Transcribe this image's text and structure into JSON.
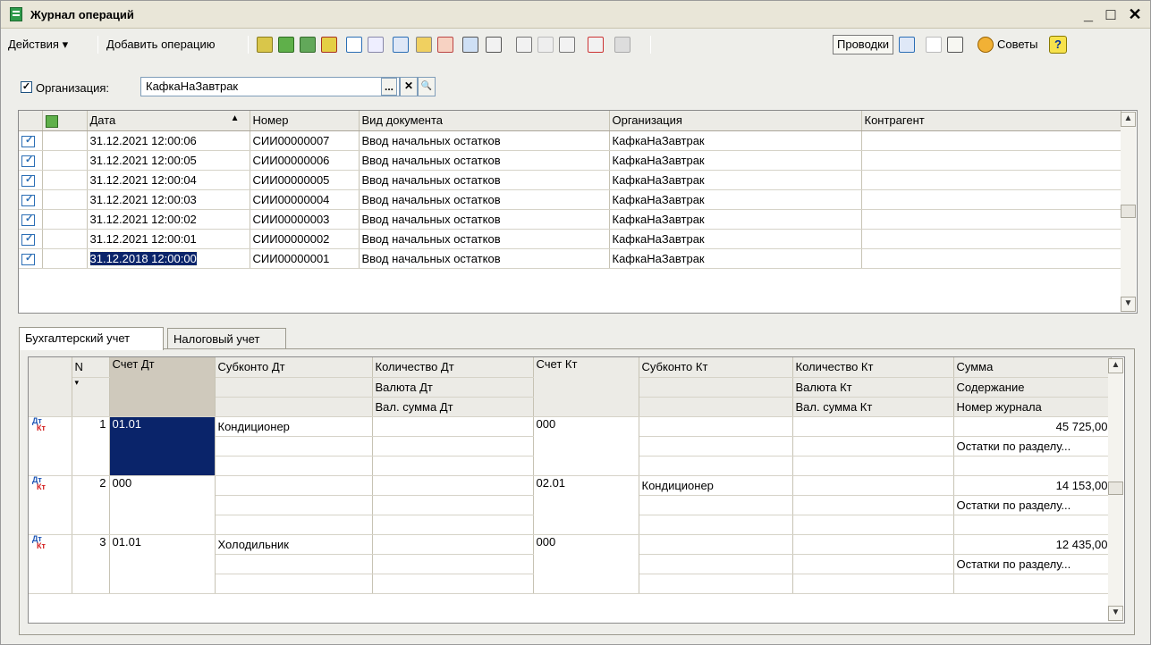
{
  "window": {
    "title": "Журнал операций",
    "minimize": "_",
    "maximize": "□",
    "close": "✕"
  },
  "toolbar": {
    "actions_label": "Действия ▾",
    "add_label": "Добавить операцию",
    "postings_label": "Проводки",
    "tips_label": "Советы",
    "help_label": "?"
  },
  "filter": {
    "checked": "✓",
    "label": "Организация:",
    "value": "КафкаНаЗавтрак",
    "btn_select": "...",
    "btn_clear": "✕",
    "btn_open": "🔍"
  },
  "journal": {
    "columns": [
      "Дата",
      "Номер",
      "Вид документа",
      "Организация",
      "Контрагент"
    ],
    "sort_arrow": "▲",
    "rows": [
      {
        "date": "31.12.2021 12:00:06",
        "number": "СИИ00000007",
        "doc_type": "Ввод начальных остатков",
        "org": "КафкаНаЗавтрак",
        "contractor": ""
      },
      {
        "date": "31.12.2021 12:00:05",
        "number": "СИИ00000006",
        "doc_type": "Ввод начальных остатков",
        "org": "КафкаНаЗавтрак",
        "contractor": ""
      },
      {
        "date": "31.12.2021 12:00:04",
        "number": "СИИ00000005",
        "doc_type": "Ввод начальных остатков",
        "org": "КафкаНаЗавтрак",
        "contractor": ""
      },
      {
        "date": "31.12.2021 12:00:03",
        "number": "СИИ00000004",
        "doc_type": "Ввод начальных остатков",
        "org": "КафкаНаЗавтрак",
        "contractor": ""
      },
      {
        "date": "31.12.2021 12:00:02",
        "number": "СИИ00000003",
        "doc_type": "Ввод начальных остатков",
        "org": "КафкаНаЗавтрак",
        "contractor": ""
      },
      {
        "date": "31.12.2021 12:00:01",
        "number": "СИИ00000002",
        "doc_type": "Ввод начальных остатков",
        "org": "КафкаНаЗавтрак",
        "contractor": ""
      },
      {
        "date": "31.12.2018 12:00:00",
        "number": "СИИ00000001",
        "doc_type": "Ввод начальных остатков",
        "org": "КафкаНаЗавтрак",
        "contractor": ""
      }
    ]
  },
  "tabs": [
    "Бухгалтерский учет",
    "Налоговый учет"
  ],
  "entries": {
    "header": {
      "n": "N",
      "n_arrow": "▾",
      "acc_dt": "Счет Дт",
      "sub_dt": "Субконто Дт",
      "qty_dt": "Количество Дт",
      "cur_dt": "Валюта Дт",
      "cursum_dt": "Вал. сумма Дт",
      "acc_kt": "Счет Кт",
      "sub_kt": "Субконто Кт",
      "qty_kt": "Количество Кт",
      "cur_kt": "Валюта Кт",
      "cursum_kt": "Вал. сумма Кт",
      "sum": "Сумма",
      "content": "Содержание",
      "journal_no": "Номер журнала"
    },
    "icon_dt": "Дт",
    "icon_kt": "Кт",
    "rows": [
      {
        "n": "1",
        "acc_dt": "01.01",
        "sub_dt": "Кондиционер",
        "acc_kt": "000",
        "sub_kt": "",
        "sum": "45 725,00",
        "content": "Остатки по разделу..."
      },
      {
        "n": "2",
        "acc_dt": "000",
        "sub_dt": "",
        "acc_kt": "02.01",
        "sub_kt": "Кондиционер",
        "sum": "14 153,00",
        "content": "Остатки по разделу..."
      },
      {
        "n": "3",
        "acc_dt": "01.01",
        "sub_dt": "Холодильник",
        "acc_kt": "000",
        "sub_kt": "",
        "sum": "12 435,00",
        "content": "Остатки по разделу..."
      }
    ]
  }
}
